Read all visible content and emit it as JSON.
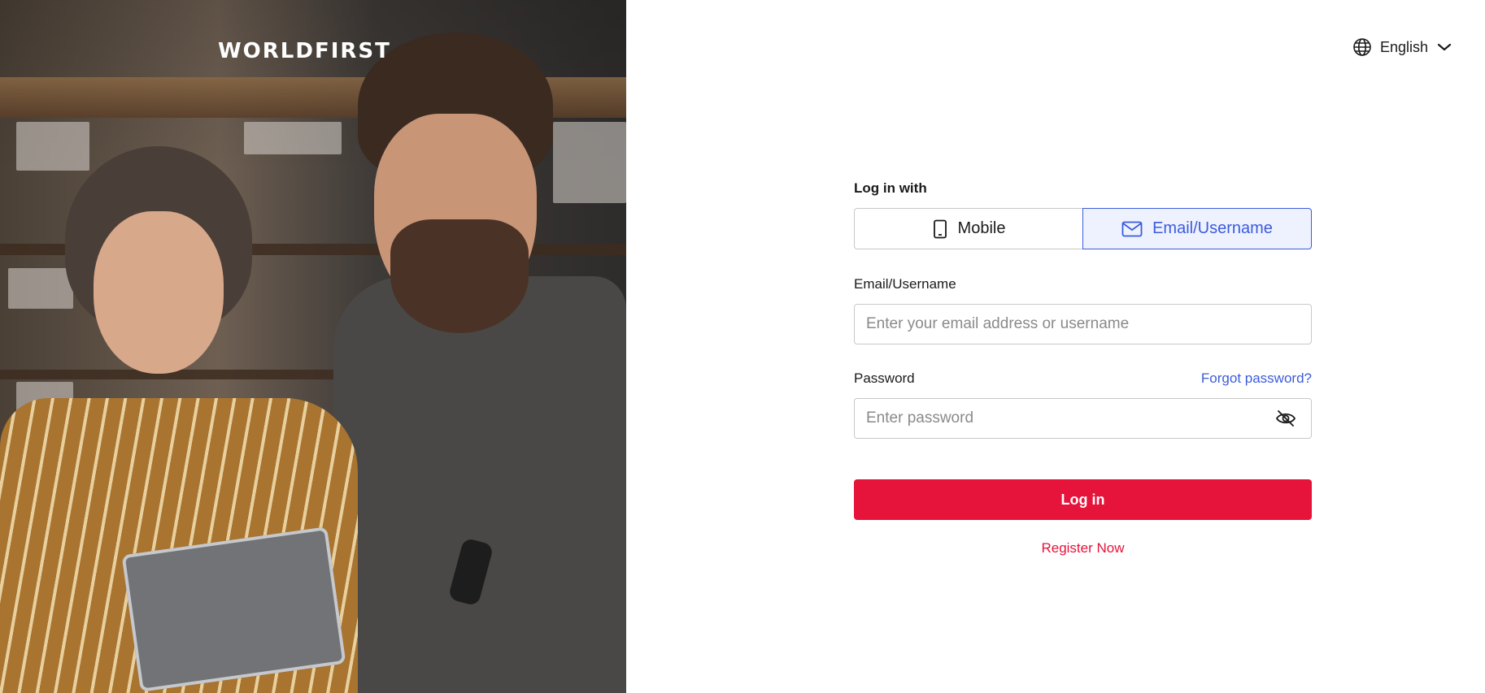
{
  "brand": {
    "logo_text": "WORLDFIRST"
  },
  "language": {
    "selected": "English"
  },
  "login": {
    "login_with_label": "Log in with",
    "tabs": [
      {
        "label": "Mobile",
        "icon": "mobile-phone-icon",
        "active": false
      },
      {
        "label": "Email/Username",
        "icon": "envelope-icon",
        "active": true
      }
    ],
    "email_label": "Email/Username",
    "email_placeholder": "Enter your email address or username",
    "password_label": "Password",
    "password_placeholder": "Enter password",
    "forgot_password": "Forgot password?",
    "submit_label": "Log in",
    "register_label": "Register Now"
  },
  "colors": {
    "primary_red": "#e6133a",
    "link_blue": "#3b5bdb",
    "active_tab_bg": "#eef2ff"
  }
}
